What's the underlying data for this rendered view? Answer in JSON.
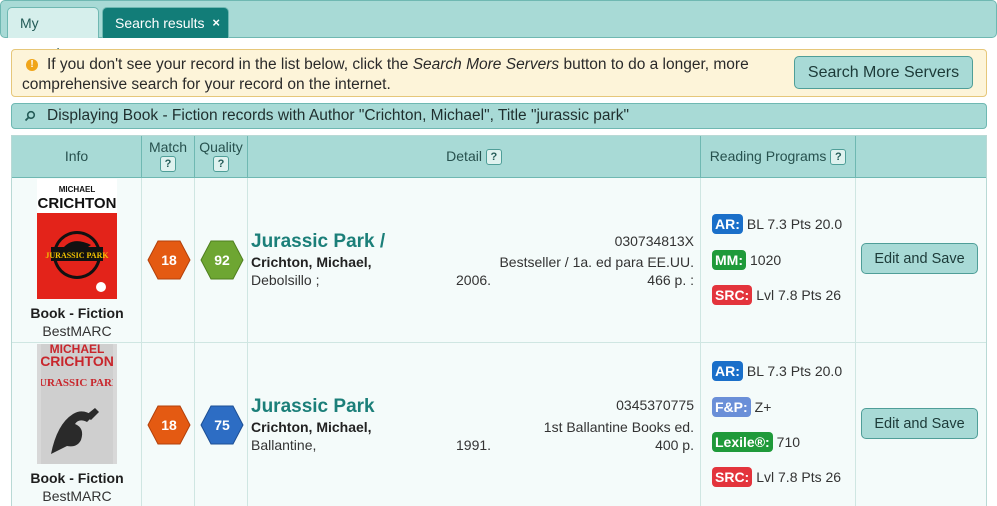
{
  "tabs": [
    {
      "label": "My records"
    },
    {
      "label": "Search results",
      "close": "×"
    }
  ],
  "notice": {
    "text_before": "If you don't see your record in the list below, click the ",
    "text_em": "Search More Servers",
    "text_after": " button to do a longer, more comprehensive search for your record on the internet.",
    "button": "Search More Servers"
  },
  "criteria": {
    "text": "Displaying Book - Fiction records with Author \"Crichton, Michael\", Title \"jurassic park\""
  },
  "headers": {
    "info": "Info",
    "match": "Match",
    "quality": "Quality",
    "detail": "Detail",
    "reading_programs": "Reading Programs",
    "help": "?"
  },
  "colors": {
    "accent": "#127d78",
    "header_bg": "#a8dad6",
    "match_hex": "#e45a12",
    "quality_green": "#6ea632",
    "quality_blue": "#2d6dc4",
    "badge_ar": "#1a6fc9",
    "badge_mm": "#1f9a3a",
    "badge_src": "#e3343c",
    "badge_fp": "#6a8fd8",
    "badge_lexile": "#1f9a3a"
  },
  "records": [
    {
      "format": "Book - Fiction",
      "source": "BestMARC",
      "cover": {
        "author": "MICHAEL",
        "author2": "CRICHTON",
        "title": "JURASSIC PARK"
      },
      "match": "18",
      "quality": "92",
      "title": "Jurassic Park /",
      "author": "Crichton, Michael,",
      "publisher": "Debolsillo ;",
      "year": "2006.",
      "isbn": "030734813X",
      "edition": "Bestseller / 1a. ed para EE.UU.",
      "pages": "466 p. :",
      "programs": [
        {
          "badge": "AR:",
          "text": "BL 7.3 Pts 20.0"
        },
        {
          "badge": "MM:",
          "text": "1020"
        },
        {
          "badge": "SRC:",
          "text": "Lvl 7.8 Pts 26"
        }
      ],
      "action": "Edit and Save"
    },
    {
      "format": "Book - Fiction",
      "source": "BestMARC",
      "cover": {
        "author": "MICHAEL",
        "author2": "CRICHTON",
        "title": "JURASSIC PARK"
      },
      "match": "18",
      "quality": "75",
      "title": "Jurassic Park",
      "author": "Crichton, Michael,",
      "publisher": "Ballantine,",
      "year": "1991.",
      "isbn": "0345370775",
      "edition": "1st Ballantine Books ed.",
      "pages": "400 p.",
      "programs": [
        {
          "badge": "AR:",
          "text": "BL 7.3 Pts 20.0"
        },
        {
          "badge": "F&P:",
          "text": "Z+"
        },
        {
          "badge": "Lexile®:",
          "text": "710"
        },
        {
          "badge": "SRC:",
          "text": "Lvl 7.8 Pts 26"
        }
      ],
      "action": "Edit and Save"
    }
  ]
}
